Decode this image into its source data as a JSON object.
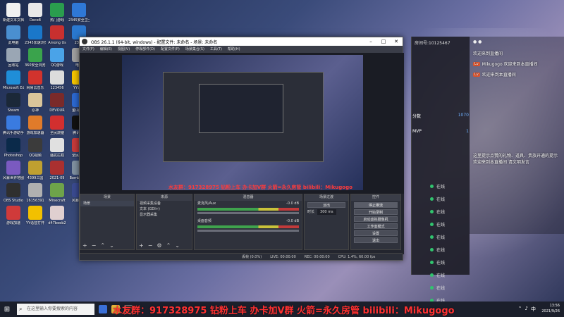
{
  "desktop": {
    "icons": [
      {
        "label": "新建文本文档",
        "color": "#f0f0f0"
      },
      {
        "label": "Dece8",
        "color": "#e8e8e8"
      },
      {
        "label": "热门游戏",
        "color": "#2a9d4e"
      },
      {
        "label": "2345安全卫士",
        "color": "#2f78d6"
      },
      {
        "label": "此电脑",
        "color": "#4a8fd0"
      },
      {
        "label": "2345加速浏览器",
        "color": "#1a77c9"
      },
      {
        "label": "Among Us",
        "color": "#c8302f"
      },
      {
        "label": "2345",
        "color": "#2a78d0"
      },
      {
        "label": "回收站",
        "color": "#9aa6b4"
      },
      {
        "label": "360安全浏览器",
        "color": "#3aa34c"
      },
      {
        "label": "QQ游戏",
        "color": "#4aa3e8"
      },
      {
        "label": "电脑",
        "color": "#a0a0a0"
      },
      {
        "label": "Microsoft Edge",
        "color": "#1f8ed8"
      },
      {
        "label": "网易云音乐",
        "color": "#d2332d"
      },
      {
        "label": "123456",
        "color": "#dcdcdc"
      },
      {
        "label": "YY语音",
        "color": "#f5c400"
      },
      {
        "label": "Steam",
        "color": "#1b2838"
      },
      {
        "label": "原神",
        "color": "#d9c59a"
      },
      {
        "label": "DEVOUR",
        "color": "#7a2a2a"
      },
      {
        "label": "金山毒霸",
        "color": "#2c68d1"
      },
      {
        "label": "腾讯手游助手",
        "color": "#3a7be0"
      },
      {
        "label": "游戏加速器",
        "color": "#e07b2a"
      },
      {
        "label": "全民烧脑",
        "color": "#d22f2f"
      },
      {
        "label": "腾讯QQ",
        "color": "#111111"
      },
      {
        "label": "Photoshop",
        "color": "#0b2a4a"
      },
      {
        "label": "QQ视频",
        "color": "#3b3b3b"
      },
      {
        "label": "骚扰拦截",
        "color": "#e0e0e0"
      },
      {
        "label": "全民烧脑",
        "color": "#c63a3a"
      },
      {
        "label": "风暴世界地图",
        "color": "#7a5ac0"
      },
      {
        "label": "4399三国",
        "color": "#c0a030"
      },
      {
        "label": "2021-09",
        "color": "#aa3030"
      },
      {
        "label": "BombsTest",
        "color": "#8090a0"
      },
      {
        "label": "OBS Studio",
        "color": "#2f2f2f"
      },
      {
        "label": "16156391",
        "color": "#b0b0b0"
      },
      {
        "label": "Minecraft",
        "color": "#6ea34a"
      },
      {
        "label": "风暴英雄",
        "color": "#3a4a90"
      },
      {
        "label": "游戏加速",
        "color": "#d03a3a"
      },
      {
        "label": "YY语音打开",
        "color": "#f2c000"
      },
      {
        "label": "d47beeb2",
        "color": "#e0d0d0"
      }
    ]
  },
  "obs": {
    "title": "OBS 26.1.1 (64-bit, windows) - 配置文件: 未命名 - 场景: 未命名",
    "menu": [
      "文件(F)",
      "编辑(E)",
      "视图(V)",
      "停靠部件(D)",
      "配置文件(P)",
      "场景集合(S)",
      "工具(T)",
      "帮助(H)"
    ],
    "preview_ticker": "水友群：917328975 钻粉上车 办卡加V群 火箭=永久房管 bilibili：Mikugogo",
    "source_label": "未选择源",
    "docks": {
      "scenes": {
        "title": "场景",
        "items": [
          "场景"
        ]
      },
      "sources": {
        "title": "来源",
        "items": [
          "视频采集设备",
          "文本 (GDI+)",
          "显示器采集"
        ]
      },
      "mixer": {
        "title": "混音器",
        "tracks": [
          {
            "name": "麦克风/Aux",
            "db": "-0.0 dB"
          },
          {
            "name": "桌面音频",
            "db": "-0.0 dB"
          }
        ]
      },
      "transitions": {
        "title": "场景过渡",
        "type": "淡出",
        "duration_label": "时长",
        "duration": "300 ms"
      },
      "controls": {
        "title": "控件",
        "buttons": [
          "停止推流",
          "开始录制",
          "启动虚拟摄像机",
          "工作室模式",
          "设置",
          "退出"
        ]
      }
    },
    "status": {
      "live": "LIVE: 00:00:00",
      "rec": "REC: 00:00:00",
      "cpu": "CPU: 1.4%, 60.00 fps",
      "dropped": "丢帧 (0.0%)"
    }
  },
  "chat": {
    "room_label": "房间号:10125467",
    "lines": [
      {
        "badge": "",
        "text": "欢迎来到直播间"
      },
      {
        "badge": "",
        "text": "Mikugogo 欢迎来到本直播间"
      },
      {
        "badge": "",
        "text": "欢迎来到本直播间"
      }
    ],
    "notice": "这里提示点赞的礼物、道具、贵族开通的提示 欢迎来到本直播间 请文明发言",
    "stats": {
      "label1": "分数",
      "v1": "1070",
      "label2": "MVP",
      "v2": "1"
    }
  },
  "online_list": [
    "在线",
    "在线",
    "在线",
    "在线",
    "在线",
    "在线",
    "在线",
    "在线",
    "在线",
    "在线"
  ],
  "taskbar": {
    "search_placeholder": "在这里输入你要搜索的内容",
    "time": "13:56",
    "date": "2021/9/26",
    "ime": "中"
  },
  "ticker": "水友群：917328975 钻粉上车 办卡加V群 火箭=永久房管 bilibili：Mikugogo"
}
